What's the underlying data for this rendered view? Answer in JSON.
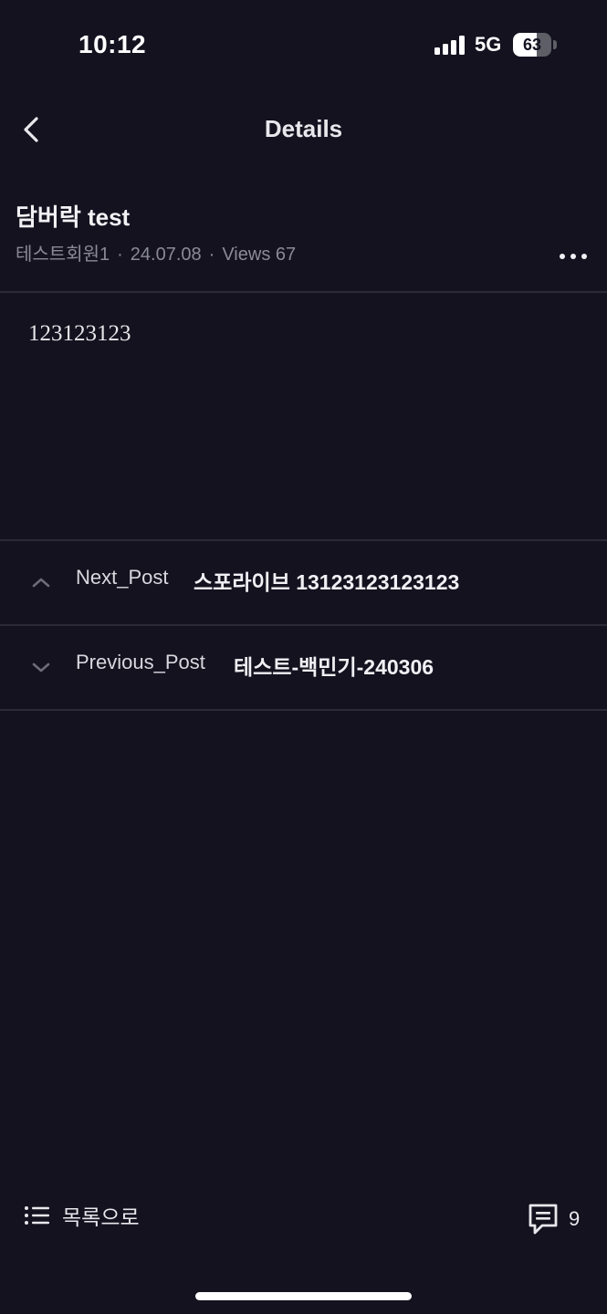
{
  "status_bar": {
    "time": "10:12",
    "network": "5G",
    "battery_level": "63",
    "battery_fraction": 0.63
  },
  "nav": {
    "title": "Details",
    "back_icon": "chevron-left-icon"
  },
  "post": {
    "title": "담버락 test",
    "author": "테스트회원1",
    "date": "24.07.08",
    "views": "Views 67",
    "body": "123123123",
    "more_icon": "more-horizontal-icon"
  },
  "post_nav": {
    "next_label": "Next_Post",
    "next_title": "스포라이브 13123123123123",
    "prev_label": "Previous_Post",
    "prev_title": "테스트-백민기-240306"
  },
  "bottom_bar": {
    "list_label": "목록으로",
    "list_icon": "list-icon",
    "comment_icon": "comment-icon",
    "comment_count": "9"
  },
  "colors": {
    "background": "#14121f",
    "divider": "#2c2a38",
    "meta_text": "#8a8a95"
  }
}
